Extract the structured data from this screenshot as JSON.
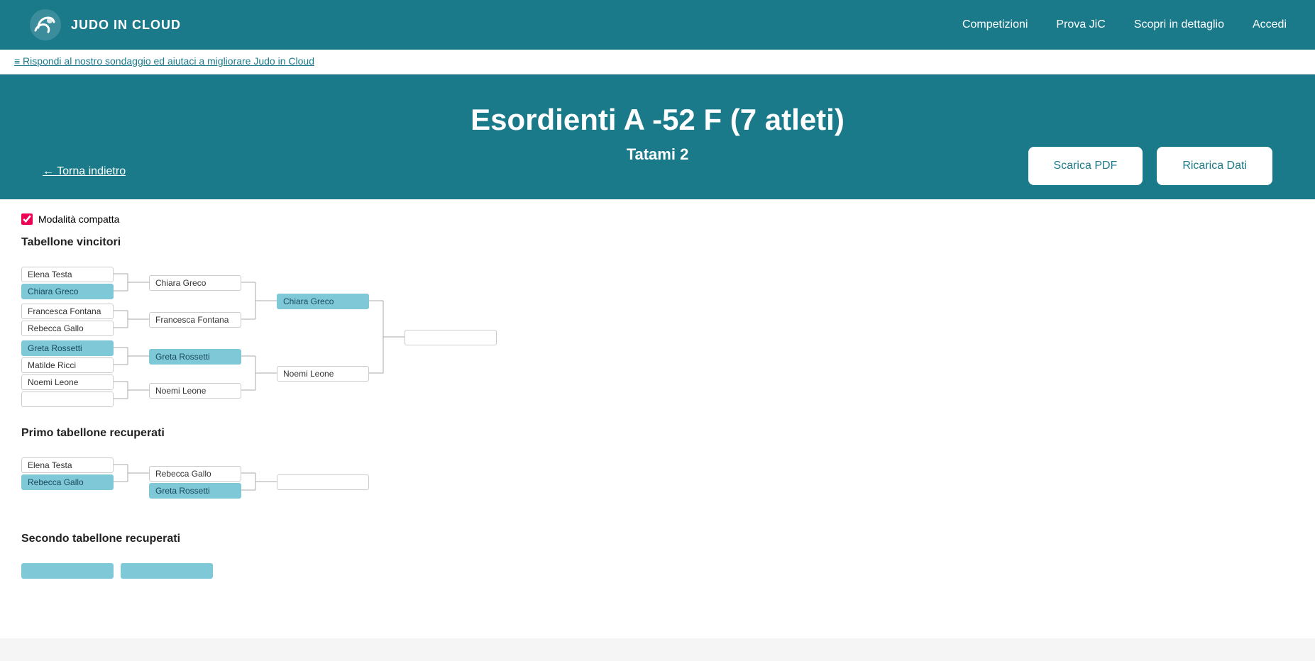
{
  "brand": {
    "name": "JUDO IN CLOUD"
  },
  "nav": {
    "links": [
      "Competizioni",
      "Prova JiC",
      "Scopri in dettaglio",
      "Accedi"
    ]
  },
  "banner": {
    "text": "≡ Rispondi al nostro sondaggio ed aiutaci a migliorare Judo in Cloud"
  },
  "hero": {
    "title": "Esordienti A -52 F (7 atleti)",
    "subtitle": "Tatami 2",
    "back_label": "← Torna indietro",
    "btn_pdf": "Scarica PDF",
    "btn_reload": "Ricarica Dati"
  },
  "compact_mode": {
    "label": "Modalità compatta",
    "checked": true
  },
  "sections": {
    "winners": {
      "title": "Tabellone vincitori",
      "rounds": {
        "r1_left": [
          {
            "name": "Elena Testa",
            "highlight": false
          },
          {
            "name": "Chiara Greco",
            "highlight": true
          },
          {
            "name": "Francesca Fontana",
            "highlight": false
          },
          {
            "name": "Rebecca Gallo",
            "highlight": false
          },
          {
            "name": "Greta Rossetti",
            "highlight": true
          },
          {
            "name": "Matilde Ricci",
            "highlight": false
          },
          {
            "name": "Noemi Leone",
            "highlight": false
          },
          {
            "name": "",
            "highlight": false
          }
        ],
        "r2": [
          {
            "name": "Chiara Greco",
            "highlight": false
          },
          {
            "name": "Francesca Fontana",
            "highlight": false
          },
          {
            "name": "Greta Rossetti",
            "highlight": true
          },
          {
            "name": "Noemi Leone",
            "highlight": false
          }
        ],
        "r3": [
          {
            "name": "Chiara Greco",
            "highlight": true
          },
          {
            "name": "Noemi Leone",
            "highlight": false
          }
        ],
        "r4": [
          {
            "name": "",
            "highlight": false
          }
        ]
      }
    },
    "first_recovery": {
      "title": "Primo tabellone recuperati",
      "r1": [
        {
          "name": "Elena Testa",
          "highlight": false
        },
        {
          "name": "Rebecca Gallo",
          "highlight": true
        }
      ],
      "r2": [
        {
          "name": "Rebecca Gallo",
          "highlight": false
        },
        {
          "name": "Greta Rossetti",
          "highlight": true
        }
      ],
      "r3": [
        {
          "name": "",
          "highlight": false
        }
      ]
    },
    "second_recovery": {
      "title": "Secondo tabellone recuperati"
    }
  }
}
